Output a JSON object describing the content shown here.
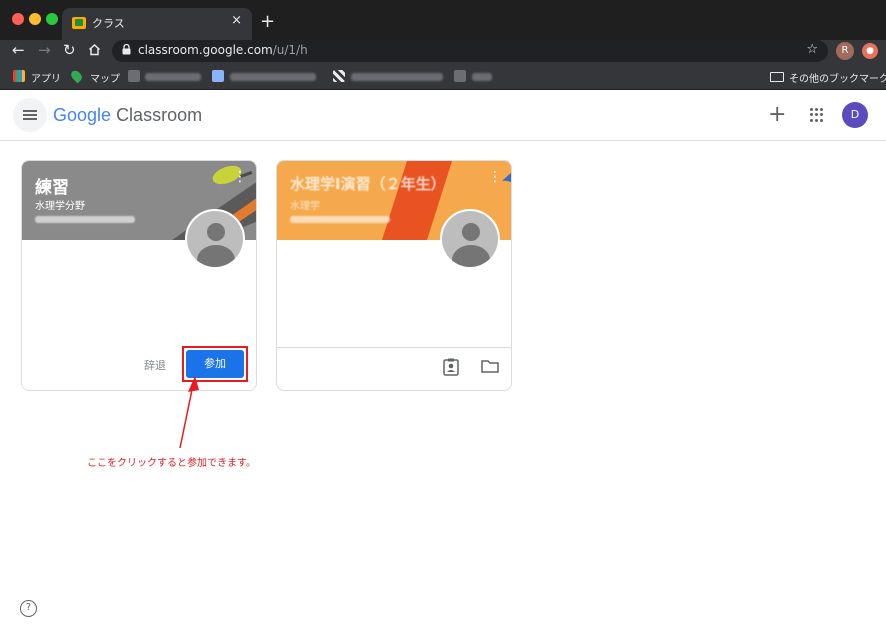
{
  "browser": {
    "tab_title": "クラス",
    "tab_close": "×",
    "new_tab": "+",
    "url_host": "classroom.google.com",
    "url_path": "/u/1/h",
    "profile_initial": "R",
    "bookmarks": {
      "apps": "アプリ",
      "maps": "マップ",
      "other": "その他のブックマーク"
    }
  },
  "app": {
    "logo_google": "Google",
    "logo_product": "Classroom",
    "add_icon": "+",
    "account_initial": "D"
  },
  "cards": [
    {
      "title": "練習",
      "subtitle": "水理学分野",
      "decline_label": "辞退",
      "join_label": "参加"
    },
    {
      "title": "水理学I演習（２年生）",
      "subtitle": "水理学"
    }
  ],
  "annotation": {
    "text": "ここをクリックすると参加できます。",
    "color": "#e61b23"
  },
  "help_label": "?",
  "colors": {
    "join_button": "#1a73e8",
    "card1_banner": "#8a8a8a",
    "card2_banner": "#f6a94c"
  }
}
